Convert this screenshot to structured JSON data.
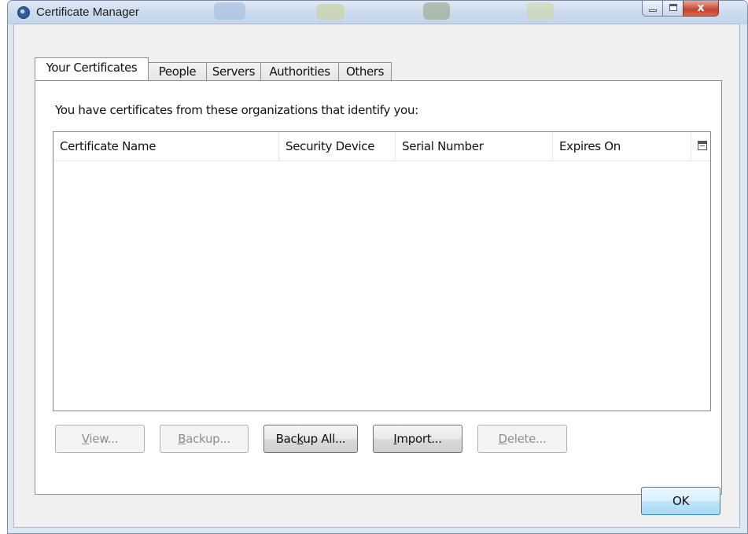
{
  "window": {
    "title": "Certificate Manager",
    "close_glyph": "x"
  },
  "tabs": [
    {
      "label": "Your Certificates",
      "active": true
    },
    {
      "label": "People",
      "active": false
    },
    {
      "label": "Servers",
      "active": false
    },
    {
      "label": "Authorities",
      "active": false
    },
    {
      "label": "Others",
      "active": false
    }
  ],
  "panel": {
    "intro_text": "You have certificates from these organizations that identify you:",
    "columns": [
      "Certificate Name",
      "Security Device",
      "Serial Number",
      "Expires On"
    ],
    "rows": []
  },
  "buttons": {
    "view": {
      "label_pre": "",
      "label_key": "V",
      "label_post": "iew...",
      "enabled": false
    },
    "backup": {
      "label_pre": "",
      "label_key": "B",
      "label_post": "ackup...",
      "enabled": false
    },
    "backup_all": {
      "label_pre": "Bac",
      "label_key": "k",
      "label_post": "up All...",
      "enabled": true
    },
    "import": {
      "label_pre": "",
      "label_key": "I",
      "label_post": "mport...",
      "enabled": true
    },
    "delete": {
      "label_pre": "",
      "label_key": "D",
      "label_post": "elete...",
      "enabled": false
    },
    "ok": {
      "label": "OK",
      "enabled": true
    }
  },
  "icons": {
    "app": "firefox-app-icon",
    "column_picker": "column-picker-icon"
  }
}
